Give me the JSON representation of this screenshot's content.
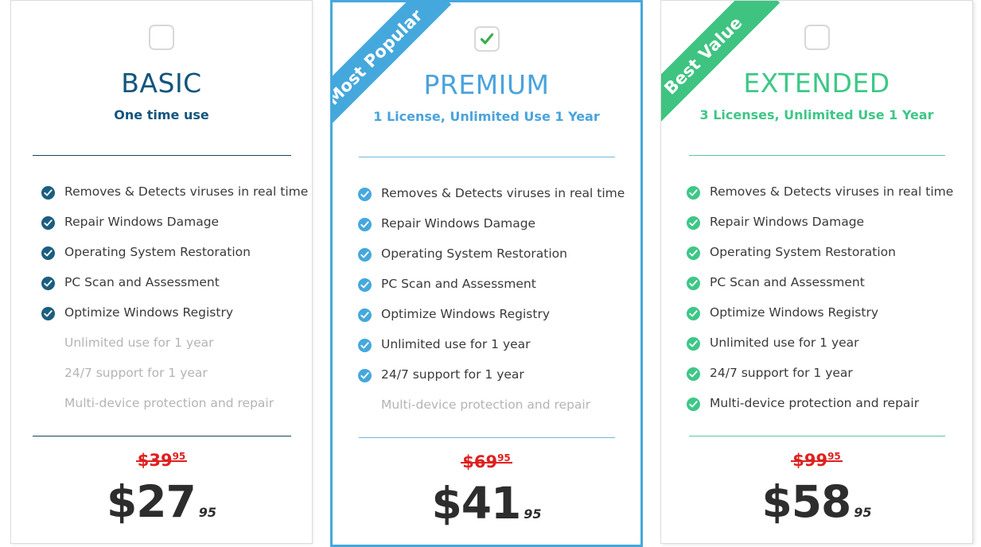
{
  "plans": [
    {
      "id": "basic",
      "name": "BASIC",
      "subtitle": "One time use",
      "ribbon": null,
      "checkbox_state": "unchecked",
      "checkbox_icon": "checkbox-empty-icon",
      "accent_color": "#12557d",
      "check_icon_color": "#1b5e80",
      "divider_color": "#14465f",
      "features": [
        {
          "label": "Removes & Detects viruses in real time",
          "included": true
        },
        {
          "label": "Repair Windows Damage",
          "included": true
        },
        {
          "label": "Operating System Restoration",
          "included": true
        },
        {
          "label": "PC Scan and Assessment",
          "included": true
        },
        {
          "label": "Optimize Windows Registry",
          "included": true
        },
        {
          "label": "Unlimited use for 1 year",
          "included": false
        },
        {
          "label": "24/7 support for 1 year",
          "included": false
        },
        {
          "label": "Multi-device protection and repair",
          "included": false
        }
      ],
      "old_price": "$39",
      "old_price_cents": "95",
      "price": "$27",
      "price_cents": "95"
    },
    {
      "id": "premium",
      "name": "PREMIUM",
      "subtitle": "1 License, Unlimited Use 1 Year",
      "ribbon": "Most Popular",
      "ribbon_color": "#45a8dd",
      "checkbox_state": "checked",
      "checkbox_icon": "checkbox-checked-icon",
      "accent_color": "#4aa3dc",
      "check_icon_color": "#45a8dd",
      "divider_color": "#6fb8dd",
      "features": [
        {
          "label": "Removes & Detects viruses in real time",
          "included": true
        },
        {
          "label": "Repair Windows Damage",
          "included": true
        },
        {
          "label": "Operating System Restoration",
          "included": true
        },
        {
          "label": "PC Scan and Assessment",
          "included": true
        },
        {
          "label": "Optimize Windows Registry",
          "included": true
        },
        {
          "label": "Unlimited use for 1 year",
          "included": true
        },
        {
          "label": "24/7 support for 1 year",
          "included": true
        },
        {
          "label": "Multi-device protection and repair",
          "included": false
        }
      ],
      "old_price": "$69",
      "old_price_cents": "95",
      "price": "$41",
      "price_cents": "95"
    },
    {
      "id": "extended",
      "name": "EXTENDED",
      "subtitle": "3 Licenses, Unlimited Use 1 Year",
      "ribbon": "Best Value",
      "ribbon_color": "#3fc380",
      "checkbox_state": "unchecked",
      "checkbox_icon": "checkbox-empty-icon",
      "accent_color": "#3ec787",
      "check_icon_color": "#3ec787",
      "divider_color": "#5ec79b",
      "features": [
        {
          "label": "Removes & Detects viruses in real time",
          "included": true
        },
        {
          "label": "Repair Windows Damage",
          "included": true
        },
        {
          "label": "Operating System Restoration",
          "included": true
        },
        {
          "label": "PC Scan and Assessment",
          "included": true
        },
        {
          "label": "Optimize Windows Registry",
          "included": true
        },
        {
          "label": "Unlimited use for 1 year",
          "included": true
        },
        {
          "label": "24/7 support for 1 year",
          "included": true
        },
        {
          "label": "Multi-device protection and repair",
          "included": true
        }
      ],
      "old_price": "$99",
      "old_price_cents": "95",
      "price": "$58",
      "price_cents": "95"
    }
  ],
  "colors": {
    "old_price": "#e02020",
    "price": "#2d2d2d",
    "feature_active": "#3a3a3a",
    "feature_inactive": "#b4b4b4",
    "checkmark_green": "#3bae4e"
  }
}
